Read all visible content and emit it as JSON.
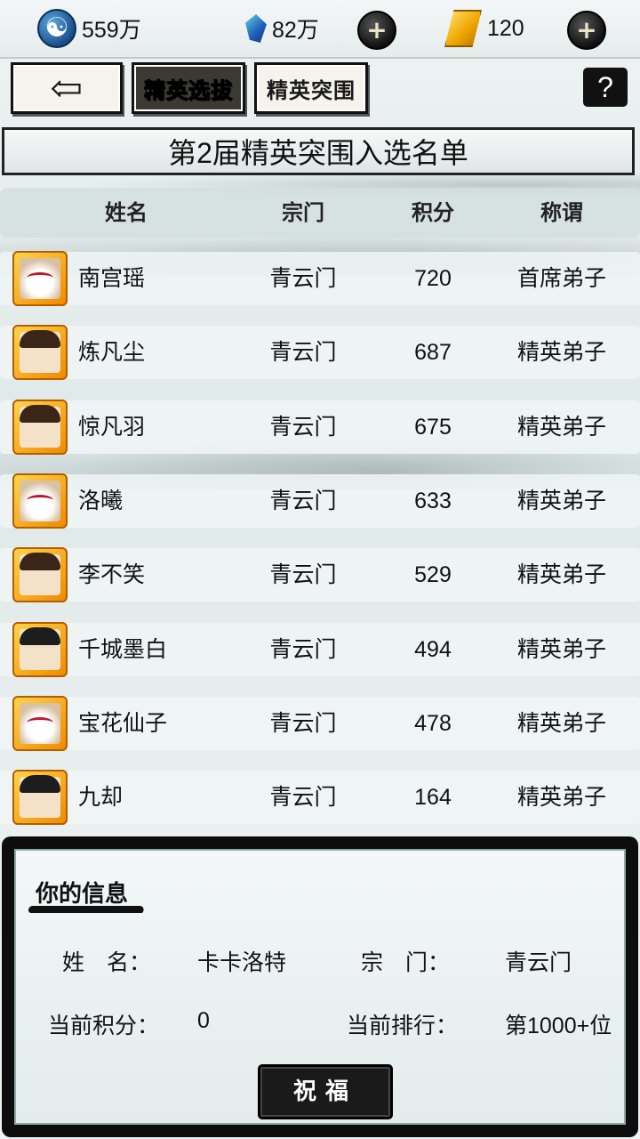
{
  "resources": {
    "jade": {
      "value": "559万",
      "icon": "yin-yang-icon"
    },
    "crystal": {
      "value": "82万",
      "icon": "blue-crystal-icon"
    },
    "gold": {
      "value": "120",
      "icon": "gold-ingot-icon"
    },
    "plus_label": "+"
  },
  "nav": {
    "back_label": "⇦",
    "tab_active": "精英选拔",
    "tab_second": "精英突围",
    "help_label": "?"
  },
  "title": "第2届精英突围入选名单",
  "table": {
    "headers": [
      "姓名",
      "宗门",
      "积分",
      "称谓"
    ],
    "rows": [
      {
        "name": "南宫瑶",
        "sect": "青云门",
        "score": "720",
        "title": "首席弟子",
        "avatar": "mask"
      },
      {
        "name": "炼凡尘",
        "sect": "青云门",
        "score": "687",
        "title": "精英弟子",
        "avatar": "long-hair"
      },
      {
        "name": "惊凡羽",
        "sect": "青云门",
        "score": "675",
        "title": "精英弟子",
        "avatar": "long-hair"
      },
      {
        "name": "洛曦",
        "sect": "青云门",
        "score": "633",
        "title": "精英弟子",
        "avatar": "mask"
      },
      {
        "name": "李不笑",
        "sect": "青云门",
        "score": "529",
        "title": "精英弟子",
        "avatar": "long-hair"
      },
      {
        "name": "千城墨白",
        "sect": "青云门",
        "score": "494",
        "title": "精英弟子",
        "avatar": "beard"
      },
      {
        "name": "宝花仙子",
        "sect": "青云门",
        "score": "478",
        "title": "精英弟子",
        "avatar": "mask"
      },
      {
        "name": "九却",
        "sect": "青云门",
        "score": "164",
        "title": "精英弟子",
        "avatar": "beard"
      }
    ]
  },
  "info": {
    "heading": "你的信息",
    "name_label": "姓　名：",
    "name_value": "卡卡洛特",
    "sect_label": "宗　门：",
    "sect_value": "青云门",
    "score_label": "当前积分：",
    "score_value": "0",
    "rank_label": "当前排行：",
    "rank_value": "第1000+位",
    "bless_button": "祝福"
  }
}
